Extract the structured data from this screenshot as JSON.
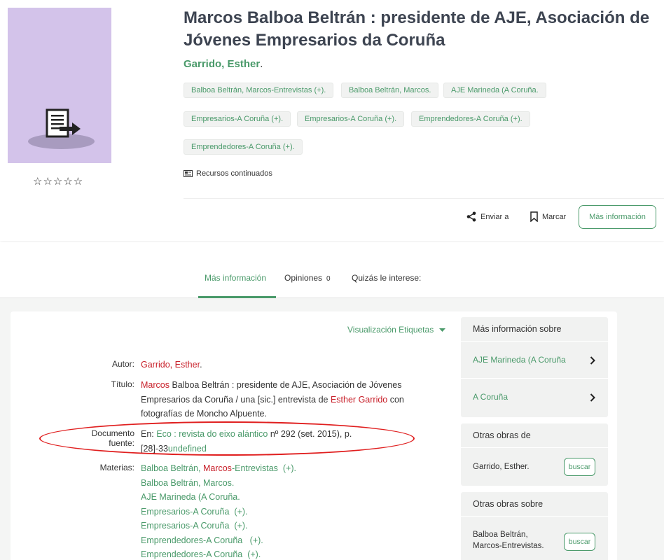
{
  "record": {
    "title": "Marcos Balboa Beltrán : presidente de AJE, Asociación de Jóvenes Empresarios da Coruña",
    "author": "Garrido, Esther",
    "author_suffix": ".",
    "stars": "☆☆☆☆☆",
    "cover_icon": "document-export-icon",
    "tags": [
      {
        "text": "Balboa Beltrán, Marcos-Entrevistas",
        "extra": "(+)."
      },
      {
        "text": "Balboa Beltrán, Marcos.",
        "extra": ""
      },
      {
        "text": "AJE Marineda (A Coruña.",
        "extra": ""
      },
      {
        "text": "Empresarios-A Coruña",
        "extra": "(+)."
      },
      {
        "text": "Empresarios-A Coruña",
        "extra": "(+)."
      },
      {
        "text": "Emprendedores-A Coruña",
        "extra": "(+)."
      },
      {
        "text": "Emprendedores-A Coruña",
        "extra": "(+)."
      }
    ],
    "resource_type": "Recursos continuados",
    "actions": {
      "send": "Enviar a",
      "mark": "Marcar",
      "more": "Más información"
    }
  },
  "tabs": [
    {
      "label": "Más información",
      "active": true
    },
    {
      "label": "Opiniones",
      "count": "0"
    },
    {
      "label": "Quizás le interese:"
    }
  ],
  "details": {
    "view_toggle": "Visualización Etiquetas",
    "autor_label": "Autor:",
    "autor_value": "Garrido, Esther",
    "autor_suffix": ".",
    "titulo_label": "Título:",
    "titulo_link": "Marcos",
    "titulo_mid": " Balboa Beltrán : presidente de AJE, Asociación de Jóvenes Empresarios da Coruña / una [sic.] entrevista de ",
    "titulo_link2": "Esther Garrido",
    "titulo_end": " con fotografías de Moncho Alpuente.",
    "documento_label": "Documento fuente:",
    "documento_prefix": "En: ",
    "documento_link": "Eco : revista do eixo alántico",
    "documento_rest": " nº 292 (set. 2015), p. [28]-33",
    "documento_tail": "undefined",
    "materias_label": "Materias:",
    "materias": [
      {
        "a": "Balboa Beltrán, ",
        "b": "Marcos",
        "c": "-Entrevistas",
        "extra": "(+)."
      },
      {
        "a": "Balboa Beltrán, Marcos.",
        "b": "",
        "c": "",
        "extra": ""
      },
      {
        "a": "AJE Marineda (A Coruña.",
        "b": "",
        "c": "",
        "extra": ""
      },
      {
        "a": "Empresarios-A Coruña",
        "b": "",
        "c": "",
        "extra": "(+)."
      },
      {
        "a": "Empresarios-A Coruña",
        "b": "",
        "c": "",
        "extra": "(+)."
      },
      {
        "a": "Emprendedores-A Coruña",
        "b": "",
        "c": "",
        "extra": "(+)."
      },
      {
        "a": "Emprendedores-A Coruña",
        "b": "",
        "c": "",
        "extra": "(+)."
      }
    ]
  },
  "sidebar": {
    "more_about": {
      "title": "Más información sobre",
      "items": [
        "AJE Marineda (A Coruña",
        "A Coruña"
      ]
    },
    "other_works_by": {
      "title": "Otras obras de",
      "author": "Garrido, Esther.",
      "button": "buscar"
    },
    "other_works_about": {
      "title": "Otras obras sobre",
      "subject_line1": "Balboa Beltrán,",
      "subject_line2": "Marcos-Entrevistas.",
      "button": "buscar"
    }
  },
  "colors": {
    "accent": "#4a9a6a",
    "link_red": "#c8202a",
    "highlight": "#e01f1f"
  }
}
